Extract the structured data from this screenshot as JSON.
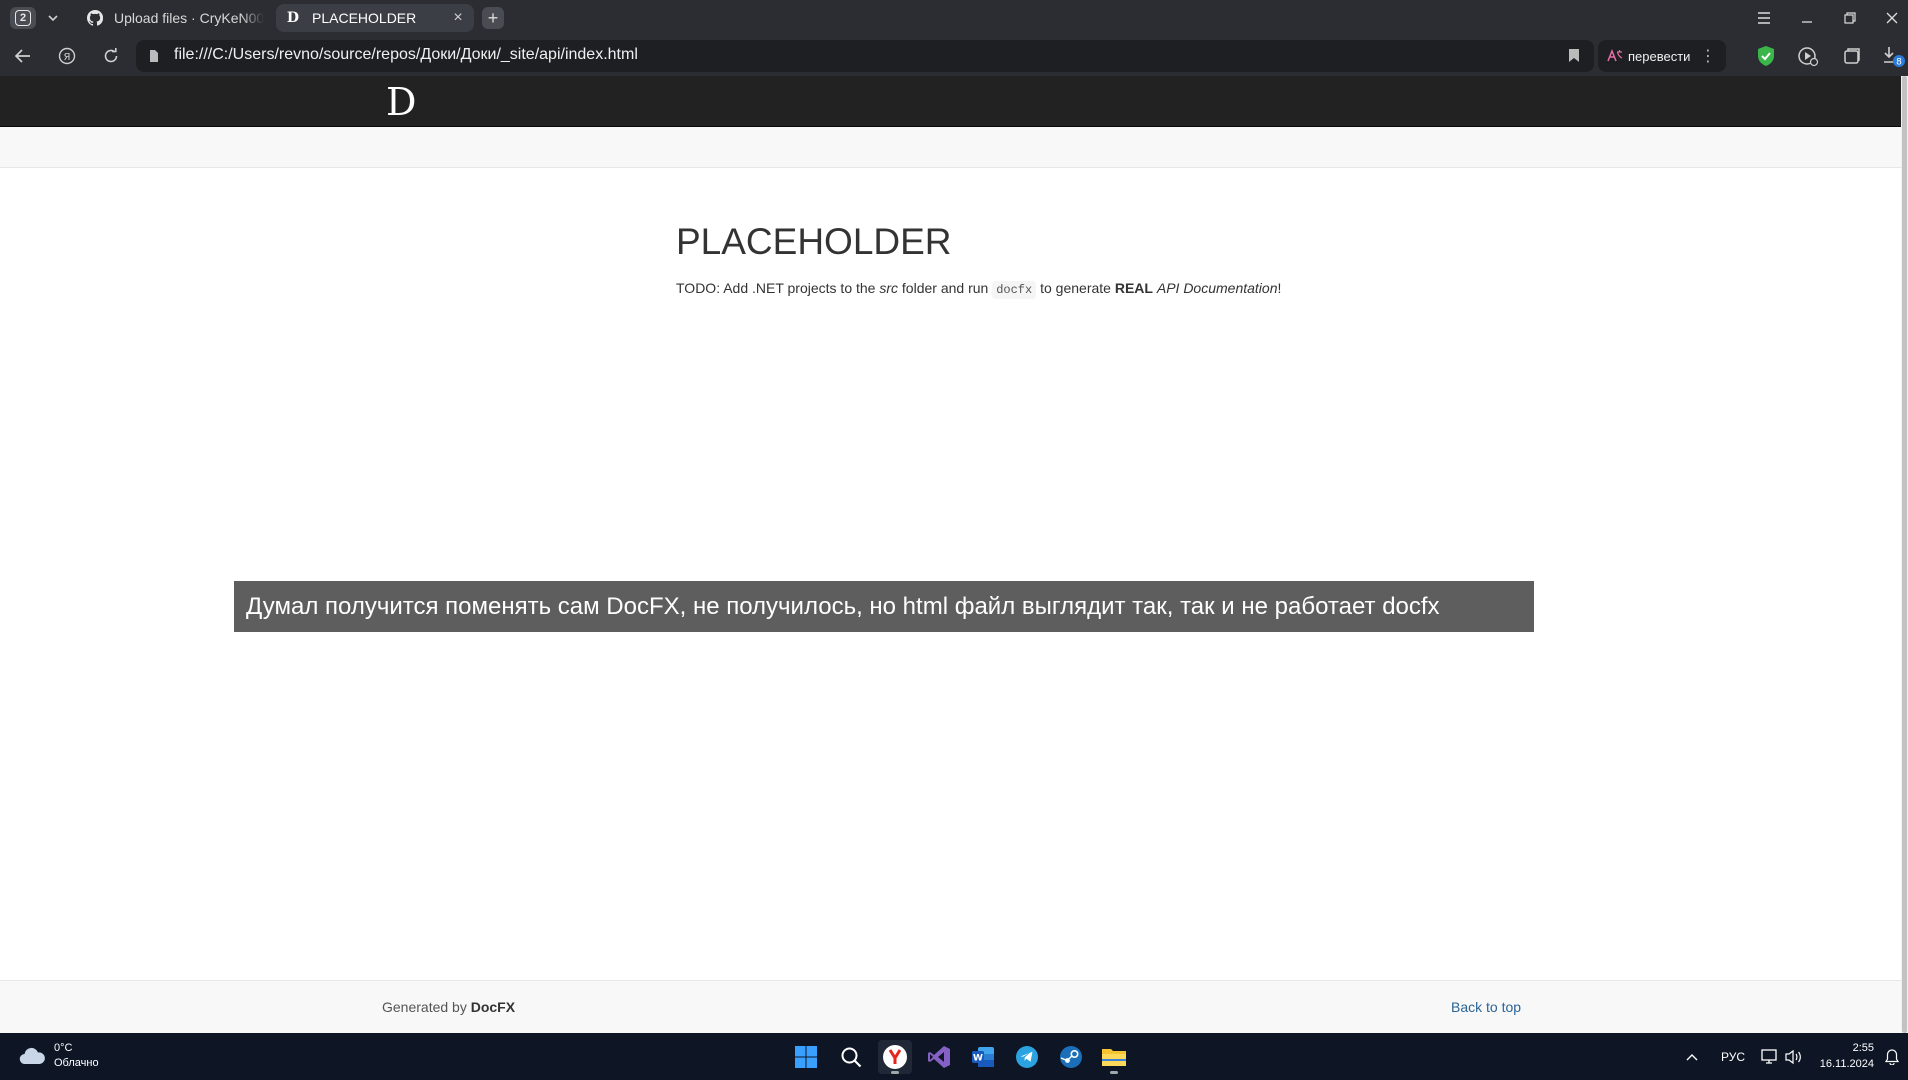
{
  "browser": {
    "tab_count": "2",
    "tabs": [
      {
        "title": "Upload files · CryKeN00/Bi",
        "favicon": "github-icon",
        "active": false
      },
      {
        "title": "PLACEHOLDER",
        "favicon": "docfx-d-icon",
        "active": true
      }
    ],
    "url": "file:///C:/Users/revno/source/repos/Доки/Доки/_site/api/index.html",
    "translate_label": "перевести",
    "downloads_badge": "8"
  },
  "site": {
    "logo_text": "D",
    "page_heading": "PLACEHOLDER",
    "todo": {
      "part1": "TODO: Add .NET projects to the ",
      "src": "src",
      "part2": " folder and run ",
      "cmd": "docfx",
      "part3": " to generate ",
      "real": "REAL",
      "space": " ",
      "api_doc": "API Documentation",
      "end": "!"
    },
    "caption_overlay": "Думал получится поменять сам DocFX, не получилось, но html файл выглядит так, так и не работает docfx",
    "footer": {
      "generated_by": "Generated by ",
      "brand": "DocFX",
      "back_to_top": "Back to top"
    }
  },
  "taskbar": {
    "weather_temp": "0°C",
    "weather_desc": "Облачно",
    "language": "РУС",
    "time": "2:55",
    "date": "16.11.2024",
    "apps": [
      "windows-start-icon",
      "search-icon",
      "yandex-browser-icon",
      "visual-studio-icon",
      "word-icon",
      "telegram-icon",
      "steam-icon",
      "file-explorer-icon"
    ]
  },
  "colors": {
    "chrome_bg": "#2b2d33",
    "site_header_bg": "#222222",
    "link": "#2a6496",
    "overlay_bg": "#505050",
    "taskbar_bg": "#0e1626"
  }
}
